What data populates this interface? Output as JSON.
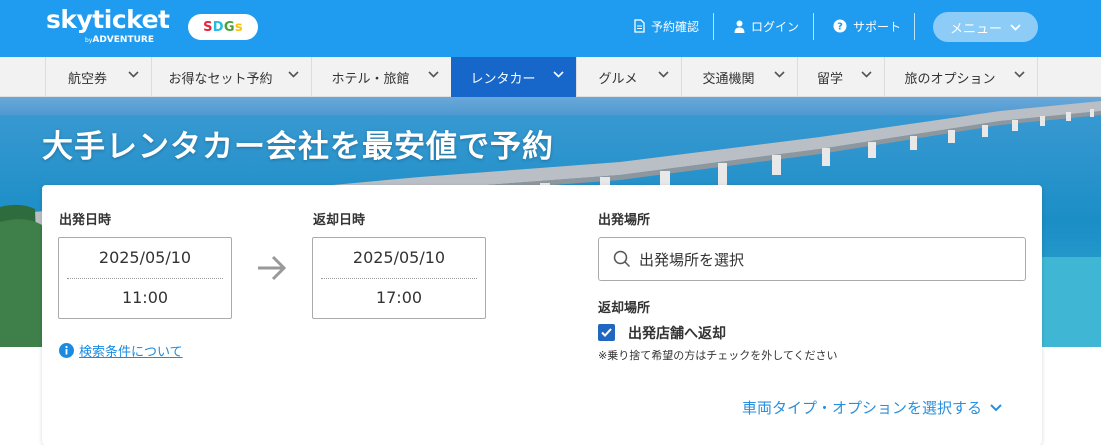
{
  "header": {
    "logo_main": "skyticket",
    "logo_by": "by",
    "logo_company": "ADVENTURE",
    "sdgs": [
      "S",
      "D",
      "G",
      "s"
    ],
    "sdgs_colors": [
      "#e5243b",
      "#26bde2",
      "#4c9f38",
      "#fcc30b"
    ],
    "links": [
      {
        "label": "予約確認",
        "icon": "document-icon"
      },
      {
        "label": "ログイン",
        "icon": "user-icon"
      },
      {
        "label": "サポート",
        "icon": "help-icon"
      }
    ],
    "menu_label": "メニュー",
    "bg_color": "#1f9bf0"
  },
  "nav": {
    "items": [
      {
        "label": "航空券"
      },
      {
        "label": "お得なセット予約"
      },
      {
        "label": "ホテル・旅館"
      },
      {
        "label": "レンタカー",
        "active": true
      },
      {
        "label": "グルメ"
      },
      {
        "label": "交通機関"
      },
      {
        "label": "留学"
      },
      {
        "label": "旅のオプション"
      }
    ],
    "active_color": "#1766c9"
  },
  "hero": {
    "title": "大手レンタカー会社を最安値で予約"
  },
  "search": {
    "departure_label": "出発日時",
    "departure_date": "2025/05/10",
    "departure_time": "11:00",
    "return_label": "返却日時",
    "return_date": "2025/05/10",
    "return_time": "17:00",
    "pickup_label": "出発場所",
    "pickup_placeholder": "出発場所を選択",
    "dropoff_label": "返却場所",
    "same_store_label": "出発店舗へ返却",
    "same_store_checked": true,
    "note": "※乗り捨て希望の方はチェックを外してください",
    "info_link": "検索条件について",
    "option_link": "車両タイプ・オプションを選択する"
  }
}
